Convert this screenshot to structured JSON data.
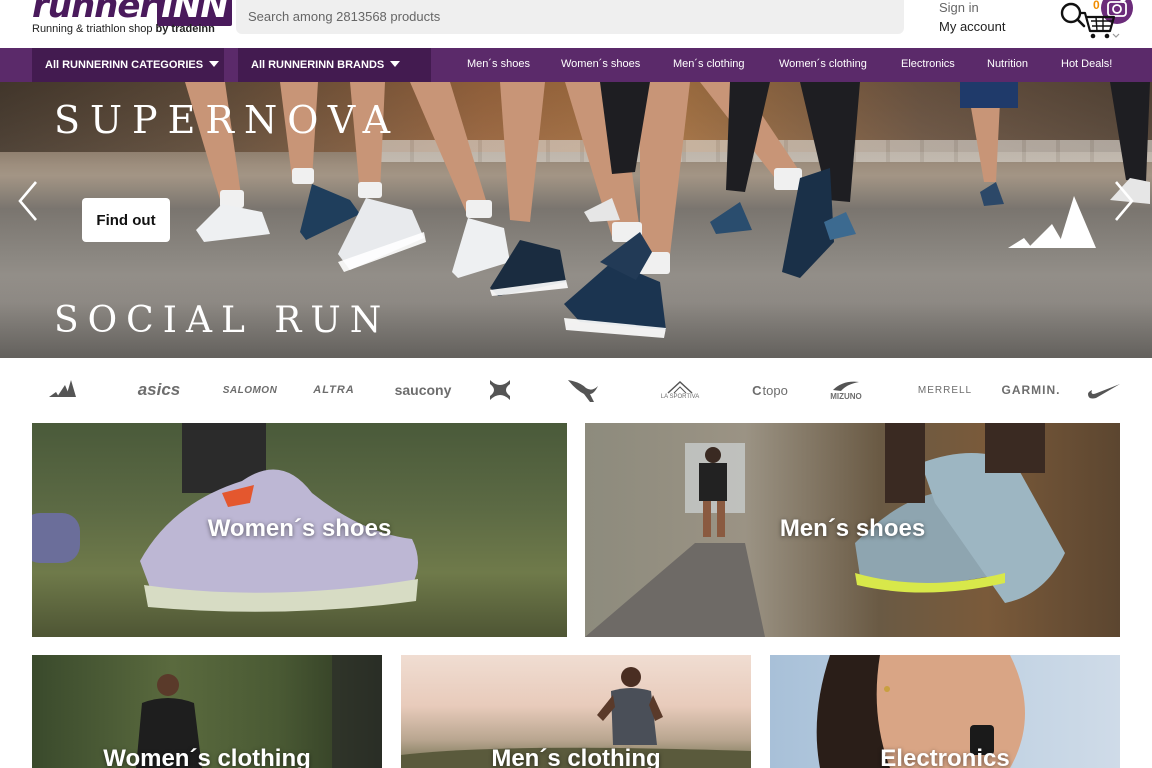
{
  "header": {
    "logo_word_main": "runner",
    "logo_word_inn": "INN",
    "logo_tagline": "Running & triathlon shop",
    "logo_tagline_by": "by tradeinn",
    "search_placeholder": "Search among 2813568 products",
    "account_line1": "Sign in",
    "account_line2": "My account",
    "cart_count": "0",
    "icons": [
      "search-icon",
      "camera-search-icon",
      "cart-icon"
    ]
  },
  "nav": {
    "categories_label": "All RUNNERINN CATEGORIES",
    "brands_label": "All RUNNERINN BRANDS",
    "links": [
      "Men´s shoes",
      "Women´s shoes",
      "Men´s clothing",
      "Women´s clothing",
      "Electronics",
      "Nutrition",
      "Hot Deals!"
    ]
  },
  "hero": {
    "title": "SUPERNOVA",
    "subtitle": "SOCIAL RUN",
    "cta_label": "Find out"
  },
  "brands": [
    "adidas",
    "asics",
    "SALOMON",
    "ALTRA",
    "saucony",
    "UNDER ARMOUR",
    "PUMA",
    "LA SPORTIVA",
    "topo",
    "MIZUNO",
    "MERRELL",
    "GARMIN",
    "NIKE"
  ],
  "brand_labels_shown": {
    "asics": "asics",
    "salomon": "SALOMON",
    "altra": "ALTRA",
    "saucony": "saucony",
    "la_sportiva": "LA SPORTIVA",
    "topo": "topo",
    "mizuno": "MIZUNO",
    "merrell": "MERRELL",
    "garmin": "GARMIN."
  },
  "tiles": {
    "womens_shoes": "Women´s shoes",
    "mens_shoes": "Men´s shoes",
    "womens_clothing": "Women´s clothing",
    "mens_clothing": "Men´s clothing",
    "electronics": "Electronics"
  },
  "colors": {
    "brand_purple": "#5b2a6a",
    "brand_purple_dark": "#431b50",
    "cart_badge": "#f08c00"
  }
}
